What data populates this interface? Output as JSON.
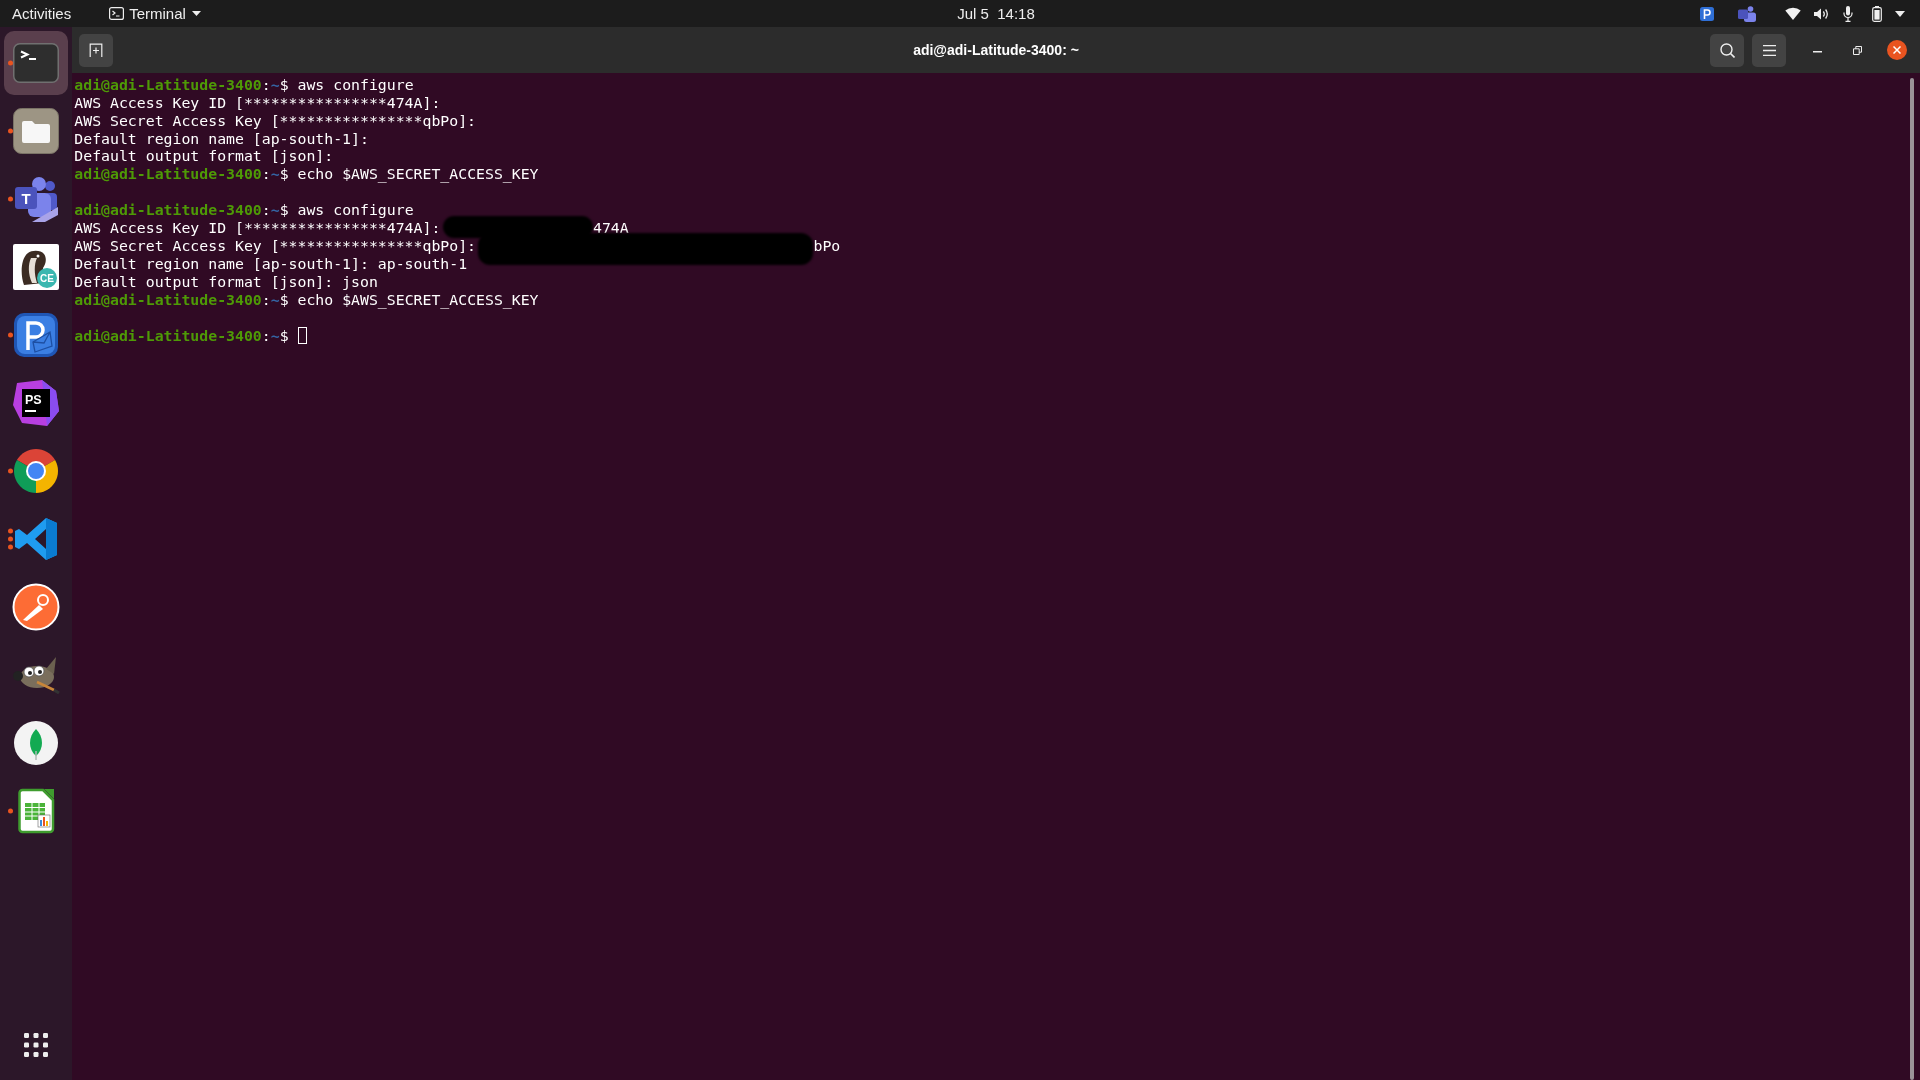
{
  "top_bar": {
    "activities": "Activities",
    "app_menu": "Terminal",
    "clock": "Jul 5  14:18"
  },
  "dock": {
    "items": [
      {
        "kind": "terminal",
        "selected": true,
        "running": true,
        "multiple": false
      },
      {
        "kind": "files",
        "selected": false,
        "running": true,
        "multiple": false
      },
      {
        "kind": "chat",
        "selected": false,
        "running": true,
        "multiple": false,
        "logo_text": "T"
      },
      {
        "kind": "database",
        "selected": false,
        "running": false,
        "multiple": false,
        "logo_text": "CE"
      },
      {
        "kind": "mail",
        "selected": false,
        "running": true,
        "multiple": false
      },
      {
        "kind": "ide",
        "selected": false,
        "running": false,
        "multiple": false,
        "logo_text": "PS"
      },
      {
        "kind": "browser",
        "selected": false,
        "running": true,
        "multiple": false
      },
      {
        "kind": "editor",
        "selected": false,
        "running": true,
        "multiple": true
      },
      {
        "kind": "api",
        "selected": false,
        "running": false,
        "multiple": false
      },
      {
        "kind": "paint",
        "selected": false,
        "running": false,
        "multiple": false
      },
      {
        "kind": "leaf",
        "selected": false,
        "running": false,
        "multiple": false
      },
      {
        "kind": "spreadsheet",
        "selected": false,
        "running": true,
        "multiple": false
      }
    ]
  },
  "window": {
    "title": "adi@adi-Latitude-3400: ~"
  },
  "terminal": {
    "lines": [
      {
        "kind": "prompt",
        "user_host": "adi@adi-Latitude-3400",
        "separator": ":",
        "path": "~",
        "symbol": "$",
        "command": "aws configure",
        "cursor": false
      },
      {
        "kind": "output",
        "text": "AWS Access Key ID [****************474A]:"
      },
      {
        "kind": "output",
        "text": "AWS Secret Access Key [****************qbPo]:"
      },
      {
        "kind": "output",
        "text": "Default region name [ap-south-1]:"
      },
      {
        "kind": "output",
        "text": "Default output format [json]:"
      },
      {
        "kind": "prompt",
        "user_host": "adi@adi-Latitude-3400",
        "separator": ":",
        "path": "~",
        "symbol": "$",
        "command": "echo $AWS_SECRET_ACCESS_KEY",
        "cursor": false
      },
      {
        "kind": "blank"
      },
      {
        "kind": "prompt",
        "user_host": "adi@adi-Latitude-3400",
        "separator": ":",
        "path": "~",
        "symbol": "$",
        "command": "aws configure",
        "cursor": false
      },
      {
        "kind": "redacted",
        "text": "AWS Access Key ID [****************474A]:",
        "tail": "474A"
      },
      {
        "kind": "redacted",
        "text": "AWS Secret Access Key [****************qbPo]:",
        "tail": "bPo"
      },
      {
        "kind": "output",
        "text": "Default region name [ap-south-1]: ap-south-1"
      },
      {
        "kind": "output",
        "text": "Default output format [json]: json"
      },
      {
        "kind": "prompt",
        "user_host": "adi@adi-Latitude-3400",
        "separator": ":",
        "path": "~",
        "symbol": "$",
        "command": "echo $AWS_SECRET_ACCESS_KEY",
        "cursor": false
      },
      {
        "kind": "blank"
      },
      {
        "kind": "prompt",
        "user_host": "adi@adi-Latitude-3400",
        "separator": ":",
        "path": "~",
        "symbol": "$",
        "cursor": true
      }
    ]
  }
}
